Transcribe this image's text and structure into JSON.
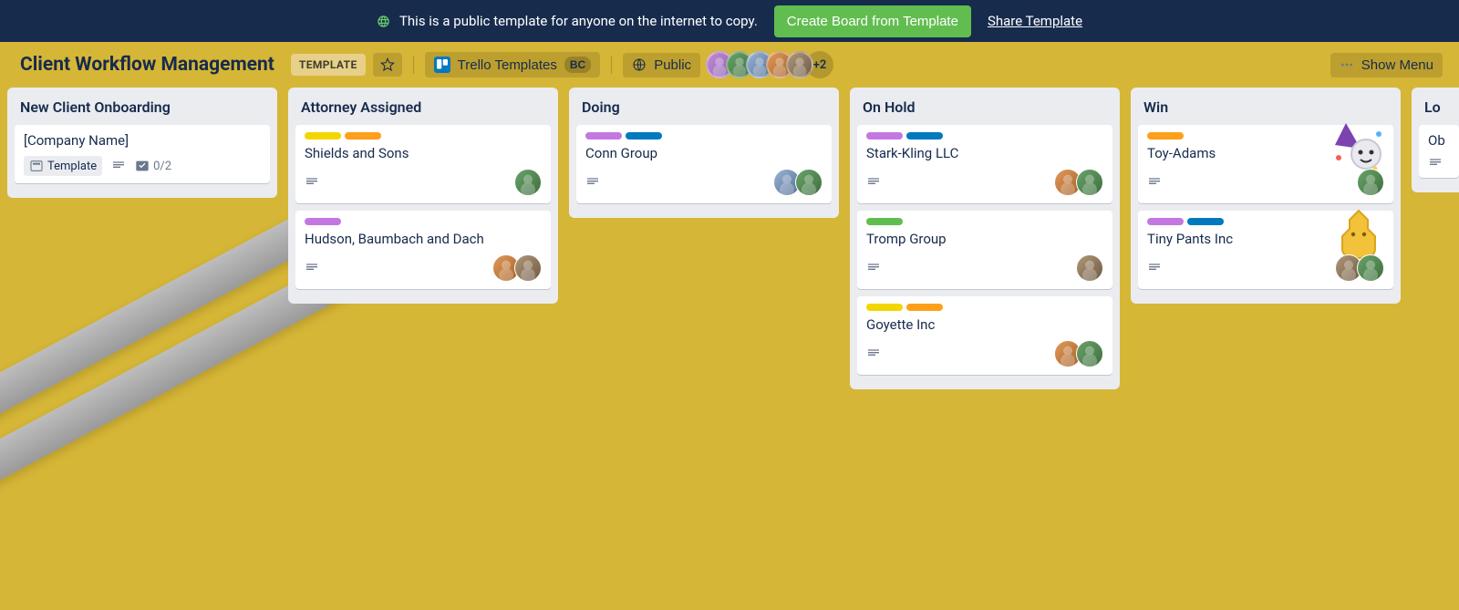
{
  "announce": {
    "message": "This is a public template for anyone on the internet to copy.",
    "create_label": "Create Board from Template",
    "share_label": "Share Template"
  },
  "header": {
    "board_title": "Client Workflow Management",
    "template_badge": "TEMPLATE",
    "workspace_label": "Trello Templates",
    "workspace_badge": "BC",
    "visibility_label": "Public",
    "extra_members": "+2",
    "show_menu": "Show Menu"
  },
  "lists": [
    {
      "title": "New Client Onboarding",
      "cards": [
        {
          "title": "[Company Name]",
          "is_template_card": true,
          "template_chip": "Template",
          "checklist": "0/2",
          "has_description": true
        }
      ]
    },
    {
      "title": "Attorney Assigned",
      "cards": [
        {
          "title": "Shields and Sons",
          "labels": [
            "yellow",
            "orange"
          ],
          "has_description": true,
          "members": [
            "c2"
          ]
        },
        {
          "title": "Hudson, Baumbach and Dach",
          "labels": [
            "purple"
          ],
          "has_description": true,
          "members": [
            "c3",
            "c4"
          ]
        }
      ]
    },
    {
      "title": "Doing",
      "cards": [
        {
          "title": "Conn Group",
          "labels": [
            "purple",
            "blue"
          ],
          "has_description": true,
          "members": [
            "c5",
            "c2"
          ]
        }
      ]
    },
    {
      "title": "On Hold",
      "cards": [
        {
          "title": "Stark-Kling LLC",
          "labels": [
            "purple",
            "blue"
          ],
          "has_description": true,
          "members": [
            "c3",
            "c2"
          ]
        },
        {
          "title": "Tromp Group",
          "labels": [
            "green"
          ],
          "has_description": true,
          "members": [
            "c4"
          ]
        },
        {
          "title": "Goyette Inc",
          "labels": [
            "yellow",
            "orange"
          ],
          "has_description": true,
          "members": [
            "c3",
            "c2"
          ]
        }
      ]
    },
    {
      "title": "Win",
      "cards": [
        {
          "title": "Toy-Adams",
          "labels": [
            "orange"
          ],
          "has_description": true,
          "sticker": "party",
          "members": [
            "c2"
          ]
        },
        {
          "title": "Tiny Pants Inc",
          "labels": [
            "purple",
            "blue"
          ],
          "has_description": true,
          "sticker": "gummy",
          "members": [
            "c4",
            "c2"
          ]
        }
      ]
    },
    {
      "title": "Lo",
      "cards": [
        {
          "title": "Ob",
          "has_description": true
        }
      ]
    }
  ]
}
